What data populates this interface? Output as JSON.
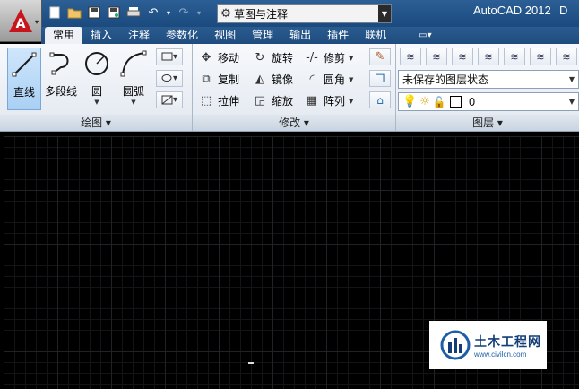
{
  "titlebar": {
    "app_title": "AutoCAD 2012",
    "app_title_cut": "D",
    "workspace": "草图与注释"
  },
  "tabs": [
    "常用",
    "插入",
    "注释",
    "参数化",
    "视图",
    "管理",
    "输出",
    "插件",
    "联机"
  ],
  "draw_panel": {
    "title": "绘图",
    "tools": [
      "直线",
      "多段线",
      "圆",
      "圆弧"
    ]
  },
  "modify_panel": {
    "title": "修改",
    "rows": [
      [
        "移动",
        "旋转",
        "修剪"
      ],
      [
        "复制",
        "镜像",
        "圆角"
      ],
      [
        "拉伸",
        "缩放",
        "阵列"
      ]
    ]
  },
  "layers_panel": {
    "title": "图层",
    "state": "未保存的图层状态",
    "current_layer": "0"
  },
  "watermark": {
    "name": "土木工程网",
    "url": "www.civilcn.com"
  },
  "colors": {
    "accent": "#1f4c7f",
    "canvas": "#000000",
    "brand_red": "#c8141c"
  }
}
